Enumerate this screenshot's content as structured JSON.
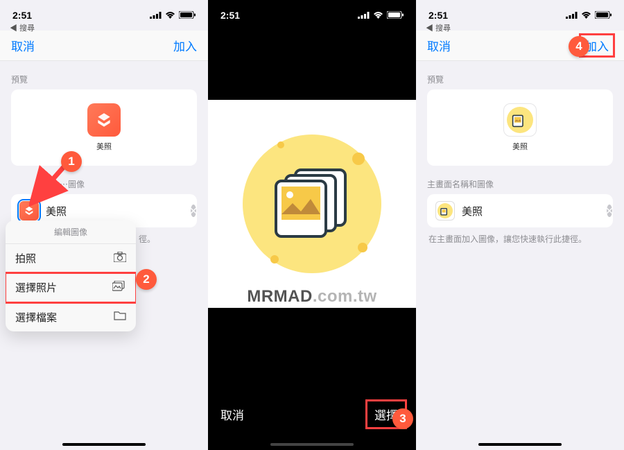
{
  "status": {
    "time": "2:51",
    "back": "◀ 搜尋"
  },
  "nav": {
    "cancel": "取消",
    "add": "加入"
  },
  "sections": {
    "preview": "預覽",
    "name_image": "主畫面名稱和圖像",
    "name_image_truncated": "主畫⋯⋯圖像"
  },
  "shortcut": {
    "name": "美照"
  },
  "hint": "在主畫面加入圖像，讓您快速執行此捷徑。",
  "popover": {
    "title": "編輯圖像",
    "take_photo": "拍照",
    "choose_photo": "選擇照片",
    "choose_file": "選擇檔案"
  },
  "picker": {
    "cancel": "取消",
    "select": "選擇"
  },
  "watermark": {
    "bold": "MRMAD",
    "rest": ".com.tw"
  },
  "callouts": {
    "c1": "1",
    "c2": "2",
    "c3": "3",
    "c4": "4"
  }
}
